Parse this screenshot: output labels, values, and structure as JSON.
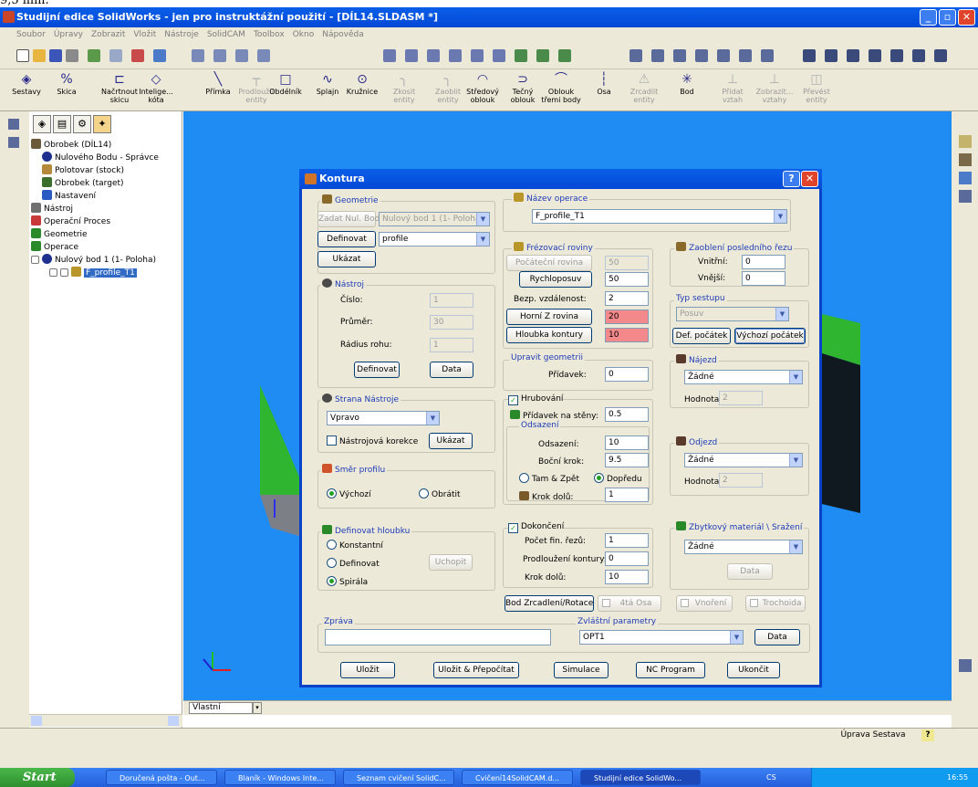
{
  "caption": "9,5 mm.",
  "window": {
    "title": "Studijní edice SolidWorks - jen pro instruktážní použití - [DÍL14.SLDASM *]",
    "min": "_",
    "max": "▫",
    "close": "✕"
  },
  "menu": [
    "Soubor",
    "Úpravy",
    "Zobrazit",
    "Vložit",
    "Nástroje",
    "SolidCAM",
    "Toolbox",
    "Okno",
    "Nápověda"
  ],
  "toolbar": [
    {
      "label": "Sestavy",
      "icon": "assembly-icon",
      "disabled": false
    },
    {
      "label": "Skica",
      "icon": "sketch-icon",
      "disabled": false
    },
    {
      "label": "Načrtnout skicu",
      "icon": "sketch-draw-icon",
      "disabled": false
    },
    {
      "label": "Intelige... kóta",
      "icon": "dimension-icon",
      "disabled": false
    },
    {
      "label": "Přímka",
      "icon": "line-icon",
      "disabled": false
    },
    {
      "label": "Prodloužit entity",
      "icon": "extend-icon",
      "disabled": true
    },
    {
      "label": "Obdélník",
      "icon": "rectangle-icon",
      "disabled": false
    },
    {
      "label": "Splajn",
      "icon": "spline-icon",
      "disabled": false
    },
    {
      "label": "Kružnice",
      "icon": "circle-icon",
      "disabled": false
    },
    {
      "label": "Zkosit entity",
      "icon": "chamfer-icon",
      "disabled": true
    },
    {
      "label": "Zaoblit entity",
      "icon": "fillet-icon",
      "disabled": true
    },
    {
      "label": "Středový oblouk",
      "icon": "center-arc-icon",
      "disabled": false
    },
    {
      "label": "Tečný oblouk",
      "icon": "tangent-arc-icon",
      "disabled": false
    },
    {
      "label": "Oblouk třemi body",
      "icon": "three-point-arc-icon",
      "disabled": false
    },
    {
      "label": "Osa",
      "icon": "axis-icon",
      "disabled": false
    },
    {
      "label": "Zrcadlit entity",
      "icon": "mirror-icon",
      "disabled": true
    },
    {
      "label": "Bod",
      "icon": "point-icon",
      "disabled": false
    },
    {
      "label": "Přidat vztah",
      "icon": "add-relation-icon",
      "disabled": true
    },
    {
      "label": "Zobrazit... vztahy",
      "icon": "show-relations-icon",
      "disabled": true
    },
    {
      "label": "Převést entity",
      "icon": "convert-icon",
      "disabled": true
    }
  ],
  "tree": [
    {
      "label": "Obrobek (DÍL14)",
      "indent": 0,
      "color": "#6b5b3a"
    },
    {
      "label": "Nulového Bodu - Správce",
      "indent": 1,
      "color": "#1d2f8f"
    },
    {
      "label": "Polotovar (stock)",
      "indent": 1,
      "color": "#b48a3a"
    },
    {
      "label": "Obrobek (target)",
      "indent": 1,
      "color": "#3a6e2a"
    },
    {
      "label": "Nastavení",
      "indent": 1,
      "color": "#2a5ac2"
    },
    {
      "label": "Nástroj",
      "indent": 0,
      "color": "#707070"
    },
    {
      "label": "Operační Proces",
      "indent": 0,
      "color": "#c83a3a"
    },
    {
      "label": "Geometrie",
      "indent": 0,
      "color": "#2a8a2a"
    },
    {
      "label": "Operace",
      "indent": 0,
      "color": "#2a8a2a"
    },
    {
      "label": "Nulový bod 1 (1- Poloha)",
      "indent": 1,
      "color": "#1d2f8f"
    }
  ],
  "tree_selected": "F_profile_T1",
  "bottom_tab": "Vlastní",
  "status": {
    "mode": "Úprava Sestava",
    "help": "?"
  },
  "taskbar": {
    "start": "Start",
    "tasks": [
      "Doručená pošta - Out...",
      "Blaník - Windows Inte...",
      "Seznam cvičení SolidC...",
      "Cvičení14SolidCAM.d...",
      "Studijní edice SolidWo..."
    ],
    "lang": "CS",
    "clock": "16:55"
  },
  "dialog": {
    "title": "Kontura",
    "help": "?",
    "close": "✕",
    "geometry": {
      "title": "Geometrie",
      "zero_button": "Zadat Nul. Bod",
      "zero_value": "Nulový bod 1 (1- Poloha)",
      "define": "Definovat",
      "geom_value": "profile",
      "show": "Ukázat"
    },
    "tool": {
      "title": "Nástroj",
      "number_label": "Číslo:",
      "number": "1",
      "diameter_label": "Průměr:",
      "diameter": "30",
      "radius_label": "Rádius rohu:",
      "radius": "1",
      "define": "Definovat",
      "data": "Data"
    },
    "tool_side": {
      "title": "Strana Nástroje",
      "value": "Vpravo",
      "correction": "Nástrojová korekce",
      "show": "Ukázat"
    },
    "profile_dir": {
      "title": "Směr profilu",
      "default": "Výchozí",
      "reverse": "Obrátit"
    },
    "depth": {
      "title": "Definovat hloubku",
      "constant": "Konstantní",
      "define": "Definovat",
      "spiral": "Spirála",
      "pick": "Uchopit"
    },
    "operation": {
      "title": "Název operace",
      "value": "F_profile_T1"
    },
    "milling": {
      "title": "Frézovací roviny",
      "start_btn": "Počáteční rovina",
      "start_val": "50",
      "rapid_btn": "Rychloposuv",
      "rapid_val": "50",
      "safe_label": "Bezp. vzdálenost:",
      "safe_val": "2",
      "upper_btn": "Horní Z rovina",
      "upper_val": "20",
      "depth_btn": "Hloubka kontury",
      "depth_val": "10"
    },
    "last_cut": {
      "title": "Zaoblení posledního řezu",
      "inner_label": "Vnitřní:",
      "inner": "0",
      "outer_label": "Vnější:",
      "outer": "0"
    },
    "approach_type": {
      "title": "Typ sestupu",
      "value": "Posuv",
      "def_start": "Def. počátek",
      "default_start": "Výchozí počátek"
    },
    "modify": {
      "title": "Upravit geometrii",
      "allow_label": "Přídavek:",
      "allow": "0"
    },
    "approach": {
      "title": "Nájezd",
      "value": "Žádné",
      "value_label": "Hodnota:",
      "value_num": "2"
    },
    "retreat": {
      "title": "Odjezd",
      "value": "Žádné",
      "value_label": "Hodnota:",
      "value_num": "2"
    },
    "roughing": {
      "label": "Hrubování",
      "wall_label": "Přídavek na stěny:",
      "wall": "0.5",
      "offset_title": "Odsazení",
      "offset_label": "Odsazení:",
      "offset": "10",
      "step_label": "Boční krok:",
      "step": "9.5",
      "zigzag": "Tam & Zpět",
      "forward": "Dopředu",
      "down_label": "Krok dolů:",
      "down": "1"
    },
    "finishing": {
      "label": "Dokončení",
      "passes_label": "Počet fin. řezů:",
      "passes": "1",
      "extend_label": "Prodloužení kontury:",
      "extend": "0",
      "down_label": "Krok dolů:",
      "down": "10"
    },
    "rest": {
      "title": "Zbytkový materiál \\ Sražení",
      "value": "Žádné",
      "data": "Data"
    },
    "extra": {
      "mirror": "Bod Zrcadlení/Rotace",
      "axis4": "4tá Osa",
      "nesting": "Vnoření",
      "trochoid": "Trochoida"
    },
    "message": {
      "title": "Zpráva",
      "value": ""
    },
    "special": {
      "title": "Zvláštní parametry",
      "value": "OPT1",
      "data": "Data"
    },
    "buttons": {
      "save": "Uložit",
      "save_recalc": "Uložit & Přepočítat",
      "sim": "Simulace",
      "nc": "NC Program",
      "exit": "Ukončit"
    }
  },
  "colors": {
    "title_blue": "#0349d6",
    "viewport": "#1e8cf2",
    "part_green": "#2fb52f",
    "dialog_bg": "#ece9d8",
    "highlight_red": "#f4898b"
  }
}
